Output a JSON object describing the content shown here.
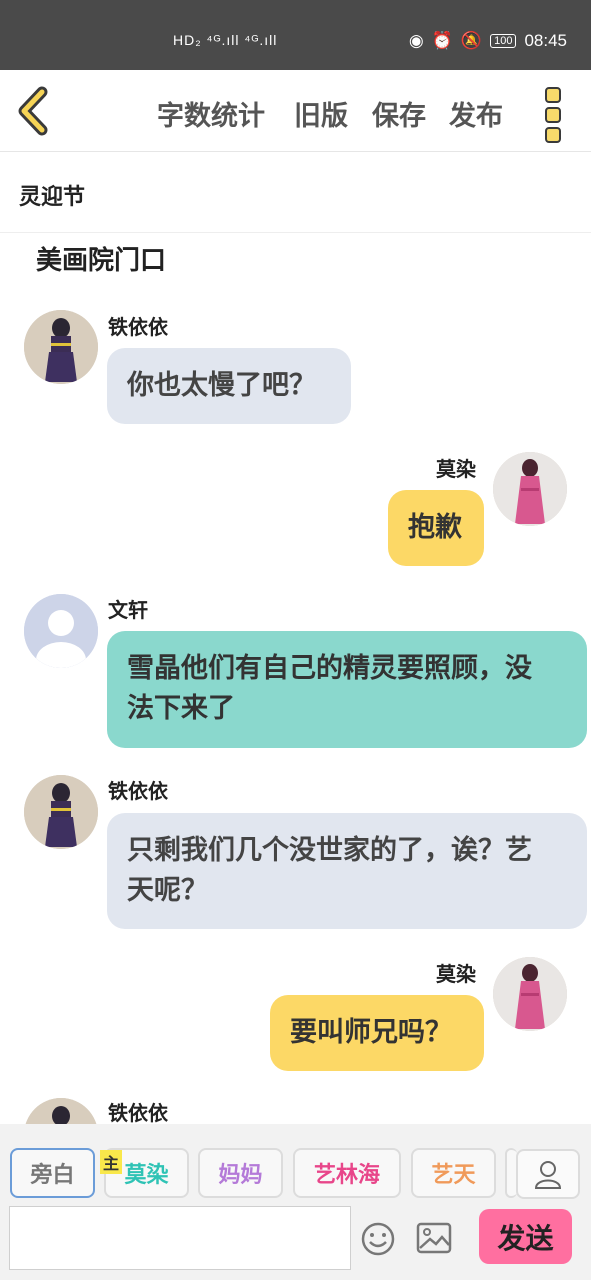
{
  "status_bar": {
    "left_icons": "HD₂ ⁴ᴳ.ıll ⁴ᴳ.ıll",
    "battery": "100",
    "time": "08:45"
  },
  "toolbar": {
    "word_count": "字数统计",
    "old_version": "旧版",
    "save": "保存",
    "publish": "发布"
  },
  "chapter_title": "灵迎节",
  "scene_title": "美画院门口",
  "messages": [
    {
      "speaker": "铁依依",
      "text": "你也太慢了吧？",
      "side": "left"
    },
    {
      "speaker": "莫染",
      "text": "抱歉",
      "side": "right"
    },
    {
      "speaker": "文轩",
      "text_line1": "雪晶他们有自己的精灵要照顾，没",
      "text_line2": "法下来了",
      "side": "left"
    },
    {
      "speaker": "铁依依",
      "text_line1": "只剩我们几个没世家的了，诶？艺",
      "text_line2": "天呢？",
      "side": "left"
    },
    {
      "speaker": "莫染",
      "text": "要叫师兄吗？",
      "side": "right"
    },
    {
      "speaker": "铁依依",
      "side": "left"
    }
  ],
  "characters": {
    "narration": "旁白",
    "main_tag": "主",
    "c1": "莫染",
    "c2": "妈妈",
    "c3": "艺林海",
    "c4": "艺天"
  },
  "colors": {
    "c1": "#2fc3b5",
    "c2": "#b47ad8",
    "c3": "#e8468a",
    "c4": "#f09a5a"
  },
  "send_label": "发送"
}
